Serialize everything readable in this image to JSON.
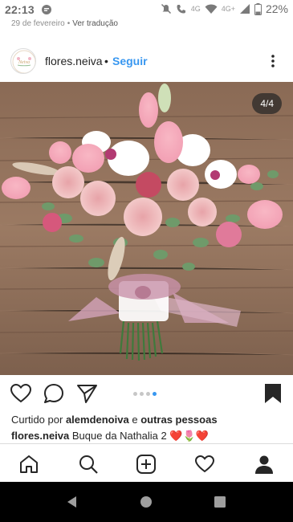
{
  "status_bar": {
    "time": "22:13",
    "net_left": "4G",
    "net_right": "4G+",
    "battery": "22%"
  },
  "post_meta": {
    "date": "29 de fevereiro",
    "translate": "Ver tradução"
  },
  "post": {
    "username": "flores.neiva",
    "follow_label": "Seguir",
    "avatar_text": "Neiva",
    "carousel_counter": "4/4",
    "carousel_total": 4,
    "carousel_active": 4,
    "likes_prefix": "Curtido por",
    "likes_user": "alemdenoiva",
    "likes_and": "e",
    "likes_others": "outras pessoas",
    "caption_user": "flores.neiva",
    "caption_text": "Buque da Nathalia 2",
    "caption_emojis": "❤️🌷❤️"
  },
  "icons": {
    "like": "heart-icon",
    "comment": "comment-icon",
    "share": "send-icon",
    "save": "bookmark-icon",
    "more": "more-options-icon",
    "nav_home": "home-icon",
    "nav_search": "search-icon",
    "nav_add": "add-post-icon",
    "nav_activity": "heart-icon",
    "nav_profile": "profile-icon"
  },
  "colors": {
    "link_blue": "#3897f0",
    "text": "#262626",
    "muted": "#8e8e8e"
  }
}
